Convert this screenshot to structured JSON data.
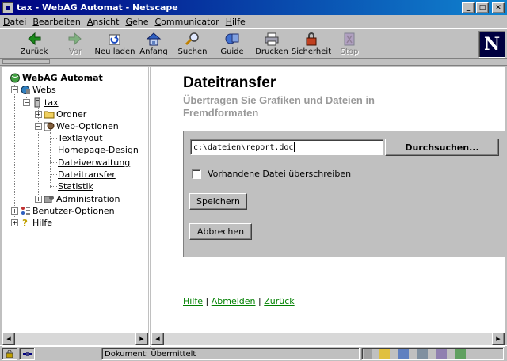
{
  "window": {
    "title": "tax - WebAG Automat - Netscape",
    "buttons": {
      "minimize": "_",
      "maximize": "□",
      "close": "✕"
    }
  },
  "menu": [
    "Datei",
    "Bearbeiten",
    "Ansicht",
    "Gehe",
    "Communicator",
    "Hilfe"
  ],
  "toolbar": {
    "items": [
      {
        "label": "Zurück",
        "icon": "back-arrow-icon",
        "enabled": true
      },
      {
        "label": "Vor",
        "icon": "forward-arrow-icon",
        "enabled": false
      },
      {
        "label": "Neu laden",
        "icon": "reload-icon",
        "enabled": true
      },
      {
        "label": "Anfang",
        "icon": "home-icon",
        "enabled": true
      },
      {
        "label": "Suchen",
        "icon": "search-icon",
        "enabled": true
      },
      {
        "label": "Guide",
        "icon": "guide-icon",
        "enabled": true
      },
      {
        "label": "Drucken",
        "icon": "print-icon",
        "enabled": true
      },
      {
        "label": "Sicherheit",
        "icon": "lock-icon",
        "enabled": true
      },
      {
        "label": "Stop",
        "icon": "stop-icon",
        "enabled": false
      }
    ],
    "logo": "N"
  },
  "tree": {
    "root": "WebAG Automat",
    "webs": "Webs",
    "tax": "tax",
    "ordner": "Ordner",
    "web_optionen": "Web-Optionen",
    "pages": [
      "Textlayout",
      "Homepage-Design",
      "Dateiverwaltung",
      "Dateitransfer",
      "Statistik"
    ],
    "administration": "Administration",
    "benutzer": "Benutzer-Optionen",
    "hilfe": "Hilfe",
    "expand_plus": "+",
    "expand_minus": "−"
  },
  "content": {
    "title": "Dateitransfer",
    "subtitle": "Übertragen Sie Grafiken und Dateien in Fremdformaten",
    "file_value": "c:\\dateien\\report.doc",
    "browse_label": "Durchsuchen...",
    "checkbox_label": "Vorhandene Datei überschreiben",
    "save_label": "Speichern",
    "cancel_label": "Abbrechen",
    "links": {
      "help": "Hilfe",
      "logout": "Abmelden",
      "back": "Zurück",
      "separator": "|"
    }
  },
  "status": {
    "text": "Dokument: Übermittelt"
  },
  "colors": {
    "titlebar_start": "#000080",
    "titlebar_end": "#1084d0",
    "link_green": "#008000",
    "subtitle_gray": "#999999",
    "chrome": "#c0c0c0"
  }
}
